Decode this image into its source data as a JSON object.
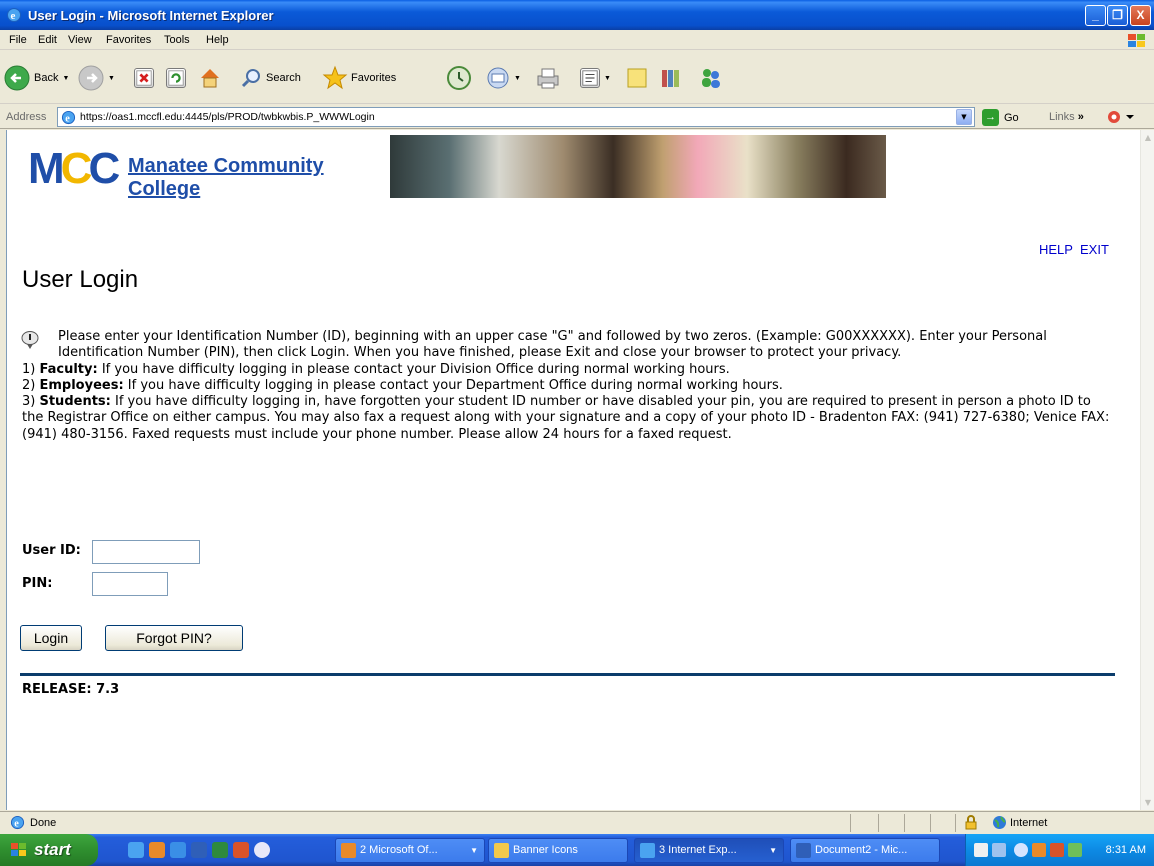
{
  "window": {
    "title": "User Login - Microsoft Internet Explorer",
    "minimize": "_",
    "maximize": "❐",
    "close": "X"
  },
  "menu": [
    "File",
    "Edit",
    "View",
    "Favorites",
    "Tools",
    "Help"
  ],
  "toolbar": {
    "back_label": "Back",
    "search_label": "Search",
    "favorites_label": "Favorites"
  },
  "address": {
    "label": "Address",
    "url": "https://oas1.mccfl.edu:4445/pls/PROD/twbkwbis.P_WWWLogin",
    "go_label": "Go",
    "links_label": "Links"
  },
  "page": {
    "college_name": "Manatee Community College",
    "help_link": "HELP",
    "exit_link": "EXIT",
    "title": "User Login",
    "info_lead": "Please enter your Identification Number (ID), beginning with an upper case \"G\" and followed by two zeros. (Example: G00XXXXXX). Enter your Personal Identification Number (PIN), then click Login. When you have finished, please Exit and close your browser to protect your privacy.",
    "notes": [
      {
        "prefix": "1)",
        "label": "Faculty:",
        "text": "If you have difficulty logging in please contact your Division Office during normal working hours."
      },
      {
        "prefix": "2)",
        "label": "Employees:",
        "text": "If you have difficulty logging in please contact your Department Office during normal working hours."
      },
      {
        "prefix": "3)",
        "label": "Students:",
        "text": "If you have difficulty logging in, have forgotten your student ID number or have disabled your pin, you are required to present in person a photo ID to the Registrar Office on either campus. You may also fax a request along with your signature and a copy of your photo ID - Bradenton FAX: (941) 727-6380; Venice FAX: (941) 480-3156. Faxed requests must include your phone number. Please allow 24 hours for a faxed request."
      }
    ],
    "user_id_label": "User ID:",
    "user_id_value": "",
    "pin_label": "PIN:",
    "pin_value": "",
    "login_button": "Login",
    "forgot_pin_button": "Forgot PIN?",
    "release": "RELEASE: 7.3"
  },
  "status": {
    "text": "Done",
    "zone": "Internet"
  },
  "taskbar": {
    "start_label": "start",
    "tasks": [
      "2 Microsoft Of...",
      "Banner Icons",
      "3 Internet Exp...",
      "Document2 - Mic..."
    ],
    "clock": "8:31 AM"
  }
}
